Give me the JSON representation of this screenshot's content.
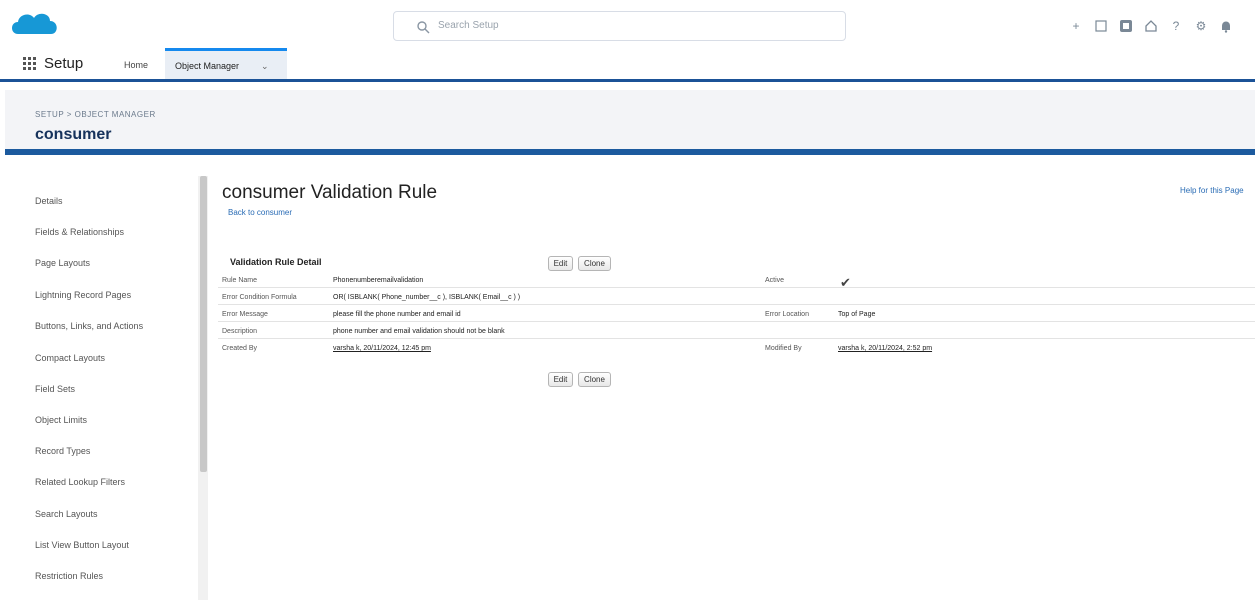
{
  "header": {
    "logo": "salesforce-cloud-logo",
    "search_placeholder": "Search Setup",
    "icons": [
      "add-icon",
      "favorites-icon",
      "waffle-icon",
      "home-icon",
      "help-icon",
      "gear-icon",
      "bell-icon"
    ]
  },
  "nav": {
    "app_name": "Setup",
    "home_label": "Home",
    "object_manager_label": "Object Manager"
  },
  "banner": {
    "breadcrumb": "SETUP > OBJECT MANAGER",
    "object_name": "consumer"
  },
  "sidebar": {
    "items": [
      "Details",
      "Fields & Relationships",
      "Page Layouts",
      "Lightning Record Pages",
      "Buttons, Links, and Actions",
      "Compact Layouts",
      "Field Sets",
      "Object Limits",
      "Record Types",
      "Related Lookup Filters",
      "Search Layouts",
      "List View Button Layout",
      "Restriction Rules"
    ]
  },
  "main": {
    "title": "consumer Validation Rule",
    "back_link": "Back to consumer",
    "help_link": "Help for this Page",
    "section_title": "Validation Rule Detail",
    "edit_label": "Edit",
    "clone_label": "Clone"
  },
  "details": {
    "rule_name_label": "Rule Name",
    "rule_name_value": "Phonenumberemailvalidation",
    "active_label": "Active",
    "formula_label": "Error Condition Formula",
    "formula_value": "OR( ISBLANK( Phone_number__c ), ISBLANK( Email__c ) )",
    "message_label": "Error Message",
    "message_value": "please fill the phone number and email id",
    "location_label": "Error Location",
    "location_value": "Top of Page",
    "description_label": "Description",
    "description_value": "phone number and email validation should not be blank",
    "created_label": "Created By",
    "created_value": "varsha k, 20/11/2024, 12:45 pm",
    "modified_label": "Modified By",
    "modified_value": "varsha k, 20/11/2024, 2:52 pm"
  }
}
